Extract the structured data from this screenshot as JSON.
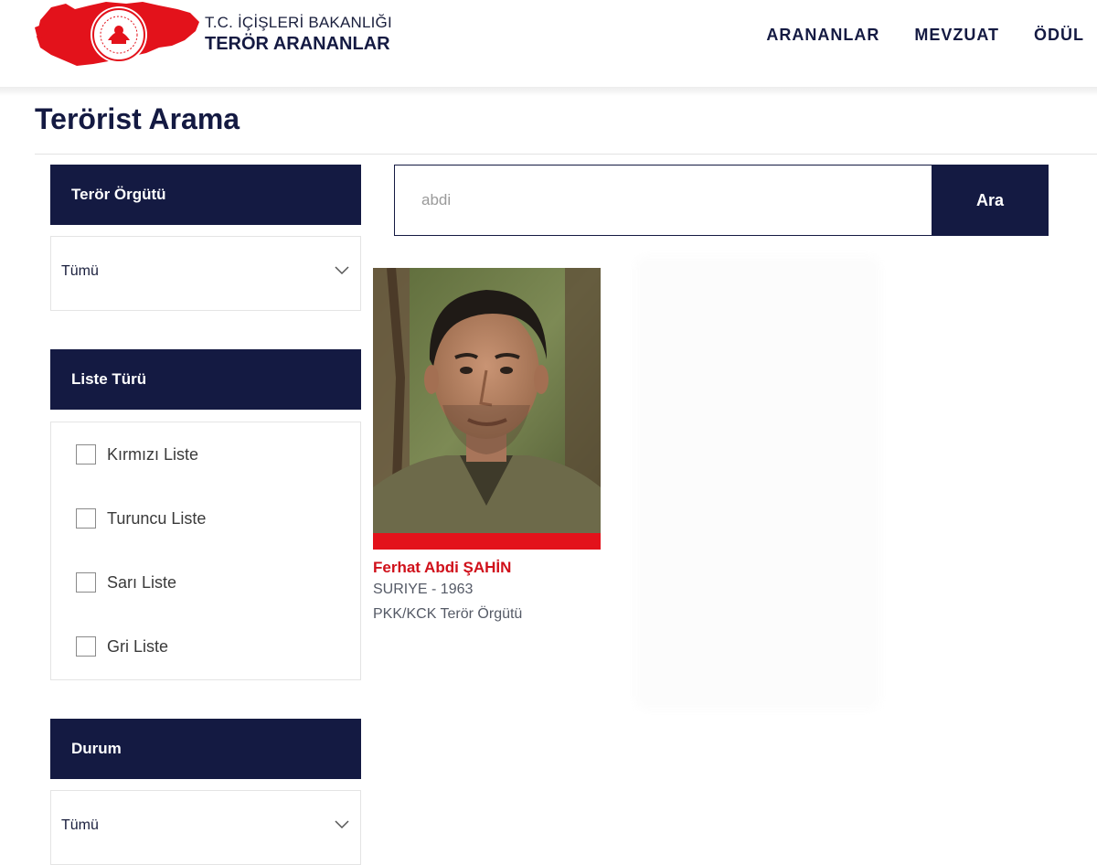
{
  "header": {
    "ministry": "T.C. İÇİŞLERİ BAKANLIĞI",
    "site_title": "TERÖR ARANANLAR",
    "logo_icon": "turkey-map-seal-logo",
    "nav": [
      {
        "label": "ARANANLAR"
      },
      {
        "label": "MEVZUAT"
      },
      {
        "label": "ÖDÜL"
      }
    ]
  },
  "page": {
    "title": "Terörist Arama"
  },
  "filters": {
    "organization": {
      "heading": "Terör Örgütü",
      "selected": "Tümü"
    },
    "list_type": {
      "heading": "Liste Türü",
      "options": [
        {
          "label": "Kırmızı Liste",
          "checked": false
        },
        {
          "label": "Turuncu Liste",
          "checked": false
        },
        {
          "label": "Sarı Liste",
          "checked": false
        },
        {
          "label": "Gri Liste",
          "checked": false
        }
      ]
    },
    "status": {
      "heading": "Durum",
      "selected": "Tümü"
    }
  },
  "search": {
    "value": "abdi",
    "button_label": "Ara"
  },
  "results": [
    {
      "name": "Ferhat Abdi ŞAHİN",
      "origin": "SURIYE - 1963",
      "organization": "PKK/KCK Terör Örgütü",
      "list_color": "#e3121b"
    }
  ],
  "colors": {
    "navy": "#141a42",
    "red": "#e3121b"
  }
}
